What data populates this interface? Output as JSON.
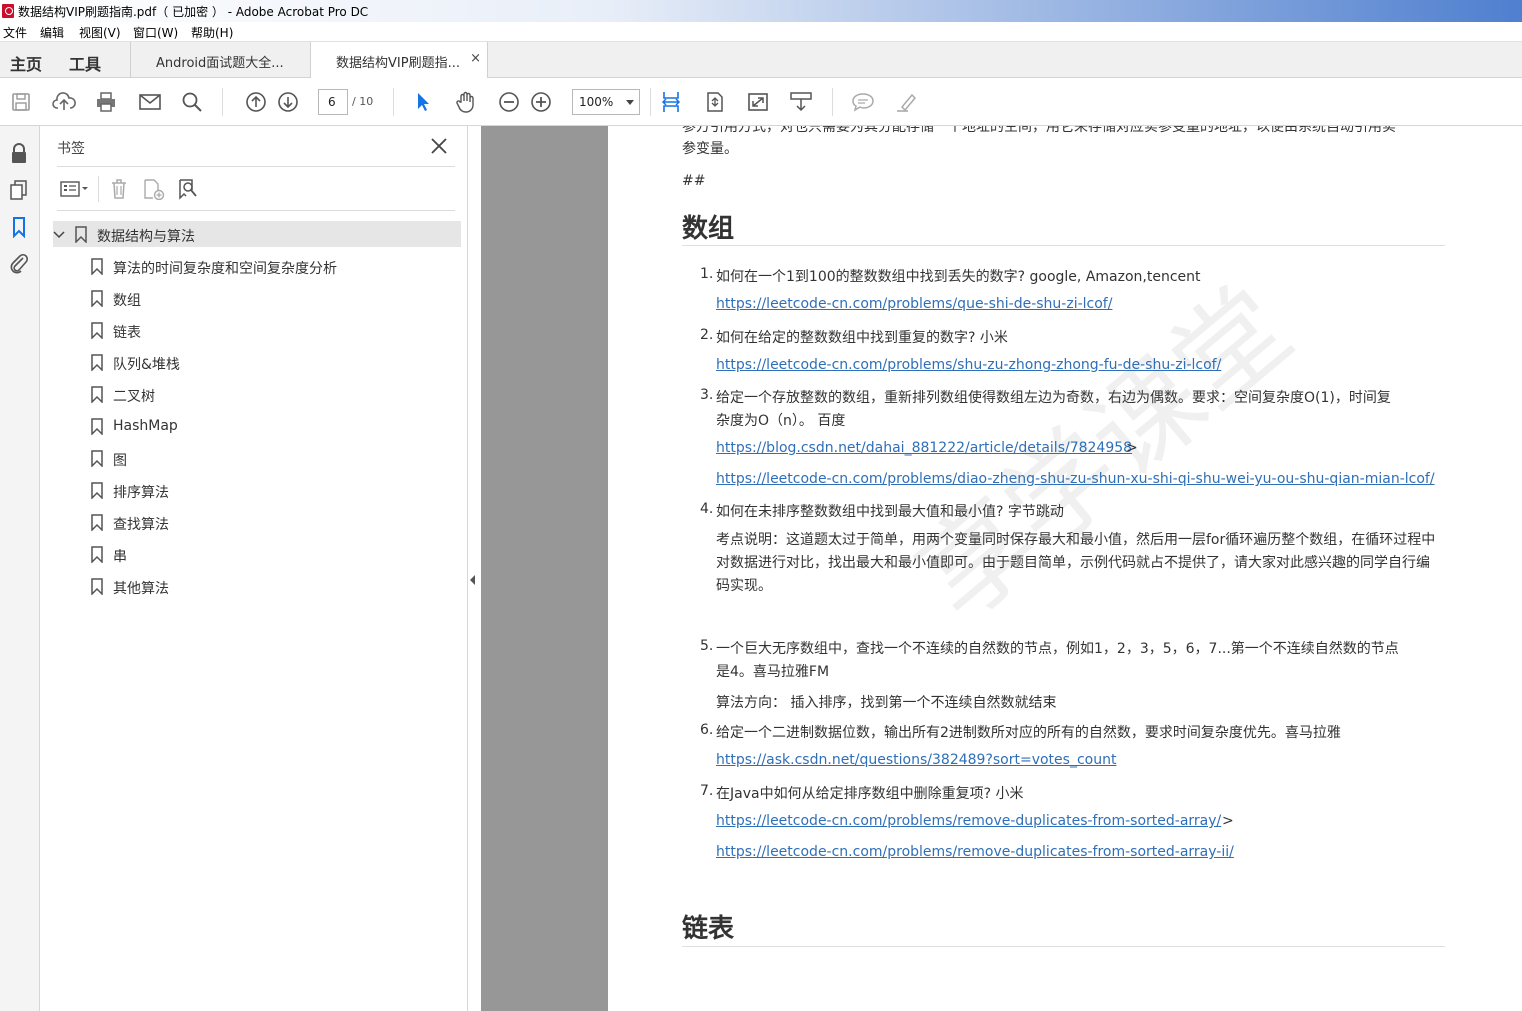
{
  "window": {
    "title": "数据结构VIP刷题指南.pdf（ 已加密 ） - Adobe Acrobat Pro DC"
  },
  "menu": {
    "items": [
      "文件",
      "编辑",
      "视图(V)",
      "窗口(W)",
      "帮助(H)"
    ]
  },
  "tabs": {
    "home": "主页",
    "tools": "工具",
    "documents": [
      {
        "label": "Android面试题大全..."
      },
      {
        "label": "数据结构VIP刷题指...",
        "close": "×"
      }
    ]
  },
  "toolbar": {
    "page_current": "6",
    "page_total": "/ 10",
    "zoom": "100%",
    "icons": [
      "save-icon",
      "upload-icon",
      "print-icon",
      "email-icon",
      "search-icon",
      "prev-page-icon",
      "next-page-icon",
      "select-cursor-icon",
      "hand-icon",
      "zoom-out-icon",
      "zoom-in-icon",
      "fit-width-icon",
      "fit-page-icon",
      "fullscreen-icon",
      "read-mode-icon",
      "comment-icon",
      "highlight-icon"
    ]
  },
  "bookmarks": {
    "title": "书签",
    "root": "数据结构与算法",
    "children": [
      "算法的时间复杂度和空间复杂度分析",
      "数组",
      "链表",
      "队列&堆栈",
      "二叉树",
      "HashMap",
      "图",
      "排序算法",
      "查找算法",
      "串",
      "其他算法"
    ]
  },
  "page": {
    "top_line_1": "参方引用方式，对也只需要为其分配存储一个地址的空间，用它来存储对应实参变量的地址，以便由系统自动引用实",
    "top_line_2": "参变量。",
    "hashes": "##",
    "section1_title": "数组",
    "items": [
      {
        "num": "1.",
        "text": "如何在一个1到100的整数数组中找到丢失的数字? google, Amazon,tencent",
        "links": [
          {
            "url": "https://leetcode-cn.com/problems/que-shi-de-shu-zi-lcof/",
            "suffix": ""
          }
        ]
      },
      {
        "num": "2.",
        "text": "如何在给定的整数数组中找到重复的数字? 小米",
        "links": [
          {
            "url": "https://leetcode-cn.com/problems/shu-zu-zhong-zhong-fu-de-shu-zi-lcof/",
            "suffix": ""
          }
        ]
      },
      {
        "num": "3.",
        "text": "给定一个存放整数的数组，重新排列数组使得数组左边为奇数，右边为偶数。要求：空间复杂度O(1)，时间复",
        "text2": "杂度为O（n）。 百度",
        "links": [
          {
            "url": "https://blog.csdn.net/dahai_881222/article/details/7824958",
            "suffix": ">"
          },
          {
            "url": "https://leetcode-cn.com/problems/diao-zheng-shu-zu-shun-xu-shi-qi-shu-wei-yu-ou-shu-qian-mian-lcof/",
            "suffix": ""
          }
        ]
      },
      {
        "num": "4.",
        "text": "如何在未排序整数数组中找到最大值和最小值? 字节跳动",
        "para": "考点说明：这道题太过于简单，用两个变量同时保存最大和最小值，然后用一层for循环遍历整个数组，在循环过程中对数据进行对比，找出最大和最小值即可。由于题目简单，示例代码就占不提供了，请大家对此感兴趣的同学自行编码实现。"
      },
      {
        "num": "5.",
        "text": "一个巨大无序数组中，查找一个不连续的自然数的节点，例如1，2，3，5，6，7...第一个不连续自然数的节点",
        "text2": "是4。喜马拉雅FM",
        "para": "算法方向： 插入排序，找到第一个不连续自然数就结束"
      },
      {
        "num": "6.",
        "text": "给定一个二进制数据位数，输出所有2进制数所对应的所有的自然数，要求时间复杂度优先。喜马拉雅",
        "links": [
          {
            "url": "https://ask.csdn.net/questions/382489?sort=votes_count",
            "suffix": ""
          }
        ]
      },
      {
        "num": "7.",
        "text": "在Java中如何从给定排序数组中删除重复项? 小米",
        "links": [
          {
            "url": "https://leetcode-cn.com/problems/remove-duplicates-from-sorted-array/",
            "suffix": ">"
          },
          {
            "url": "https://leetcode-cn.com/problems/remove-duplicates-from-sorted-array-ii/",
            "suffix": ""
          }
        ]
      }
    ],
    "section2_title": "链表",
    "watermark": "享学课堂"
  },
  "colors": {
    "link": "#2f6fb8",
    "doc_background": "#979797",
    "active_icon": "#1473e6"
  }
}
